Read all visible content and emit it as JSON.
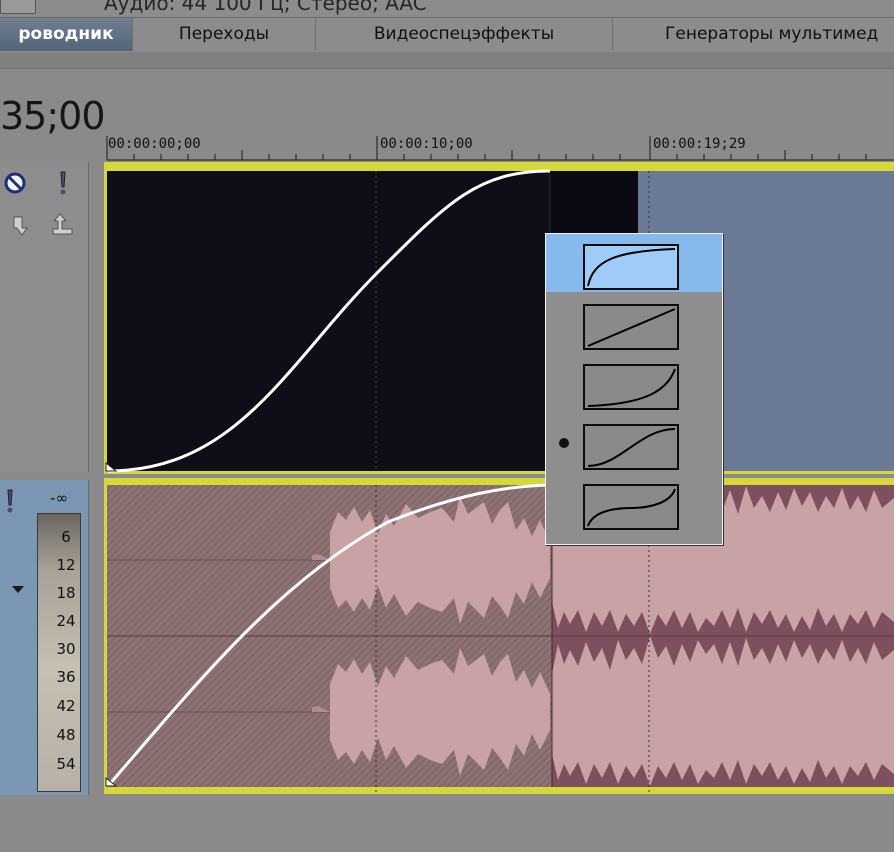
{
  "topbar": {
    "info_text": "Аудио: 44 100 Гц; Стерео; AAC"
  },
  "tabs": [
    {
      "label": "роводник",
      "active": true
    },
    {
      "label": "Переходы",
      "active": false
    },
    {
      "label": "Видеоспецэффекты",
      "active": false
    },
    {
      "label": "Генераторы мультимед",
      "active": false
    }
  ],
  "timeline": {
    "cursor_time": "35;00",
    "ruler_labels": [
      "00:00:00;00",
      "00:00:10;00",
      "00:00:19;29"
    ]
  },
  "audio_meter": {
    "top_label": "-∞",
    "scale": [
      "6",
      "12",
      "18",
      "24",
      "30",
      "36",
      "42",
      "48",
      "54"
    ]
  },
  "fade_curve_menu": {
    "items": [
      "fast-fade",
      "linear-fade",
      "slow-fade",
      "smooth-fade",
      "sharp-fade"
    ],
    "selected_index": 0,
    "current_index": 3
  },
  "colors": {
    "track_border": "#d6d83a",
    "video_event": "#0e0e18",
    "video_tail": "#6a7a95",
    "audio_event": "#8a6c70",
    "audio_tail": "#7e4f5c",
    "selection_highlight": "#86b9ec"
  }
}
